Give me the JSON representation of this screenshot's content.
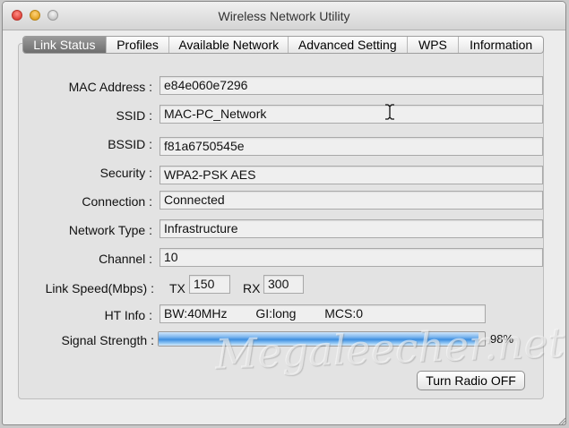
{
  "window": {
    "title": "Wireless Network Utility"
  },
  "tabs": [
    {
      "label": "Link Status",
      "active": true
    },
    {
      "label": "Profiles",
      "active": false
    },
    {
      "label": "Available Network",
      "active": false
    },
    {
      "label": "Advanced Setting",
      "active": false
    },
    {
      "label": "WPS",
      "active": false
    },
    {
      "label": "Information",
      "active": false
    }
  ],
  "fields": {
    "mac": {
      "label": "MAC Address :",
      "value": "e84e060e7296"
    },
    "ssid": {
      "label": "SSID :",
      "value": "MAC-PC_Network"
    },
    "bssid": {
      "label": "BSSID :",
      "value": "f81a6750545e"
    },
    "security": {
      "label": "Security :",
      "value": "WPA2-PSK AES"
    },
    "connection": {
      "label": "Connection :",
      "value": "Connected"
    },
    "network_type": {
      "label": "Network Type :",
      "value": "Infrastructure"
    },
    "channel": {
      "label": "Channel :",
      "value": "10"
    }
  },
  "link_speed": {
    "label": "Link Speed(Mbps) :",
    "tx_label": "TX",
    "tx": "150",
    "rx_label": "RX",
    "rx": "300"
  },
  "ht_info": {
    "label": "HT Info :",
    "bw": "BW:40MHz",
    "gi": "GI:long",
    "mcs": "MCS:0"
  },
  "signal": {
    "label": "Signal Strength :",
    "value": 98,
    "percent_text": "98%"
  },
  "button": {
    "label": "Turn Radio OFF"
  },
  "watermark": {
    "text": "Megaleecher.net"
  },
  "colors": {
    "active_tab": "#7a7a7a",
    "signal_bar": "#3e8fe0"
  }
}
